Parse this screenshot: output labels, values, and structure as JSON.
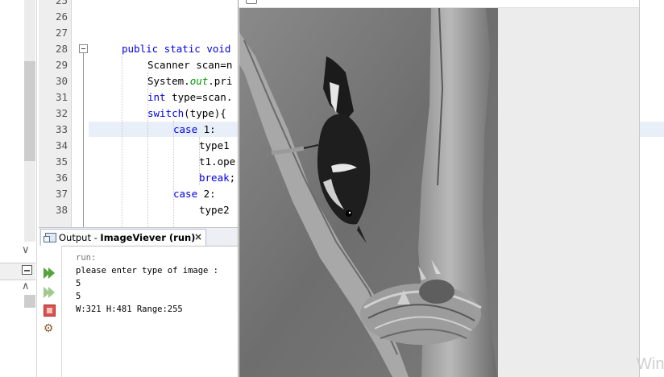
{
  "editor": {
    "lines": [
      {
        "num": "25",
        "code": ""
      },
      {
        "num": "26",
        "code": ""
      },
      {
        "num": "27",
        "code": ""
      },
      {
        "num": "28",
        "kw": "public static void",
        "rest": ""
      },
      {
        "num": "29",
        "pre": "Scanner scan=n",
        "kw": "",
        "rest": ""
      },
      {
        "num": "30",
        "pre": "System.",
        "fld": "out",
        "rest": ".pri"
      },
      {
        "num": "31",
        "kw": "int",
        "rest": " type=scan."
      },
      {
        "num": "32",
        "kw": "switch",
        "rest": "(type){"
      },
      {
        "num": "33",
        "kw": "case",
        "rest": " 1:"
      },
      {
        "num": "34",
        "pre": "type1",
        "rest": ""
      },
      {
        "num": "35",
        "pre": "t1.ope",
        "rest": ""
      },
      {
        "num": "36",
        "kw": "break",
        "rest": ";"
      },
      {
        "num": "37",
        "kw": "case",
        "rest": " 2:"
      },
      {
        "num": "38",
        "pre": "type2",
        "rest": ""
      }
    ]
  },
  "output_panel": {
    "tab_prefix": "Output - ",
    "tab_title": "ImageViever (run)",
    "tab_close": "×",
    "console_lines": [
      "run:",
      "please enter type of image :",
      "5",
      "5",
      "W:321 H:481 Range:255"
    ]
  },
  "viewer": {
    "image_subject": "grayscale photo of a bird perched on a branch above a nest"
  },
  "watermark": "Win",
  "icons": {
    "fold": "minus-box-icon",
    "run": "run-again-icon",
    "rerun": "rerun-icon",
    "stop": "stop-icon",
    "settings": "settings-icon",
    "output_tab": "output-window-icon",
    "minimize": "minimize-icon"
  }
}
